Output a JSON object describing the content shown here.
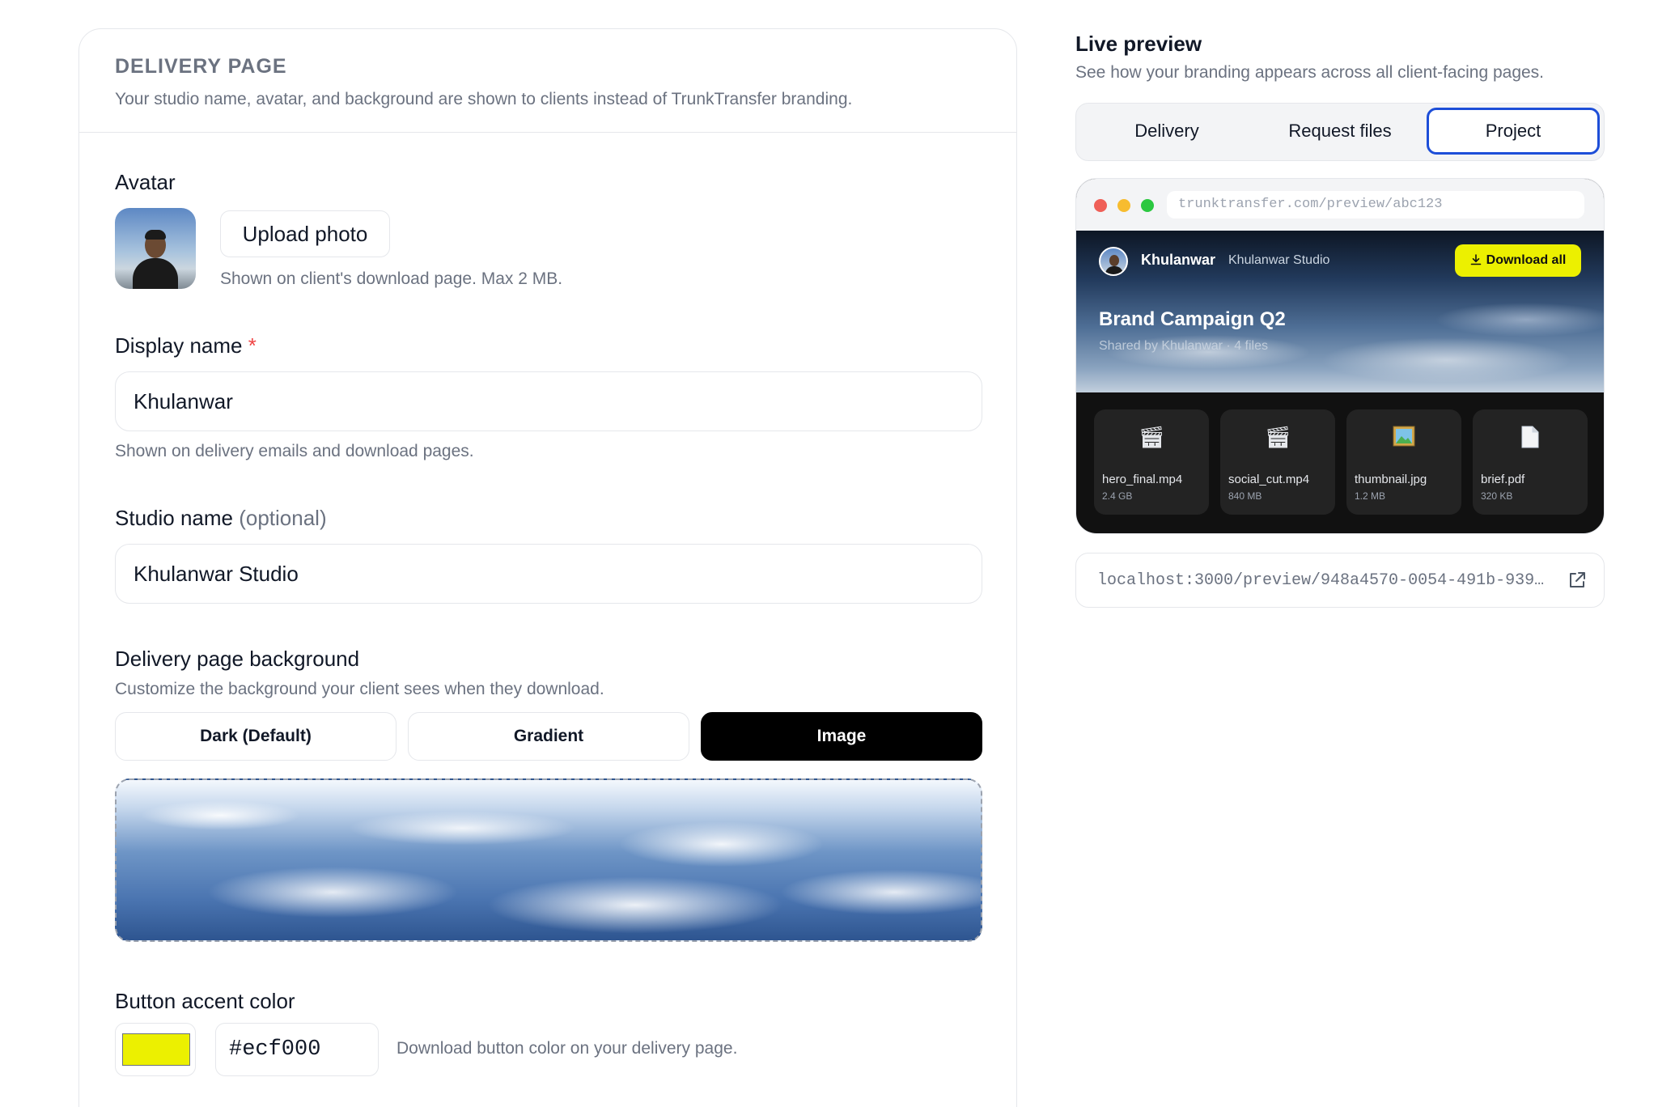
{
  "settings": {
    "section_title": "DELIVERY PAGE",
    "section_subtitle": "Your studio name, avatar, and background are shown to clients instead of TrunkTransfer branding.",
    "avatar": {
      "label": "Avatar",
      "upload_label": "Upload photo",
      "help": "Shown on client's download page. Max 2 MB."
    },
    "display_name": {
      "label": "Display name",
      "required_mark": "*",
      "value": "Khulanwar",
      "help": "Shown on delivery emails and download pages."
    },
    "studio_name": {
      "label": "Studio name",
      "optional_label": "(optional)",
      "value": "Khulanwar Studio"
    },
    "background": {
      "label": "Delivery page background",
      "help": "Customize the background your client sees when they download.",
      "options": [
        "Dark (Default)",
        "Gradient",
        "Image"
      ],
      "selected": "Image"
    },
    "accent": {
      "label": "Button accent color",
      "value": "#ecf000",
      "help": "Download button color on your delivery page."
    }
  },
  "preview": {
    "title": "Live preview",
    "subtitle": "See how your branding appears across all client-facing pages.",
    "tabs": [
      "Delivery",
      "Request files",
      "Project"
    ],
    "active_tab": "Project",
    "browser": {
      "url": "trunktransfer.com/preview/abc123",
      "dot_colors": [
        "#ef5f57",
        "#f7bc2f",
        "#2bc840"
      ]
    },
    "page": {
      "name": "Khulanwar",
      "studio": "Khulanwar Studio",
      "download_label": "Download all",
      "project_title": "Brand Campaign Q2",
      "meta": "Shared by Khulanwar · 4 files",
      "files": [
        {
          "icon": "clapper-icon",
          "name": "hero_final.mp4",
          "size": "2.4 GB"
        },
        {
          "icon": "clapper-icon",
          "name": "social_cut.mp4",
          "size": "840 MB"
        },
        {
          "icon": "image-icon",
          "name": "thumbnail.jpg",
          "size": "1.2 MB"
        },
        {
          "icon": "document-icon",
          "name": "brief.pdf",
          "size": "320 KB"
        }
      ]
    },
    "link": "localhost:3000/preview/948a4570-0054-491b-939…"
  }
}
